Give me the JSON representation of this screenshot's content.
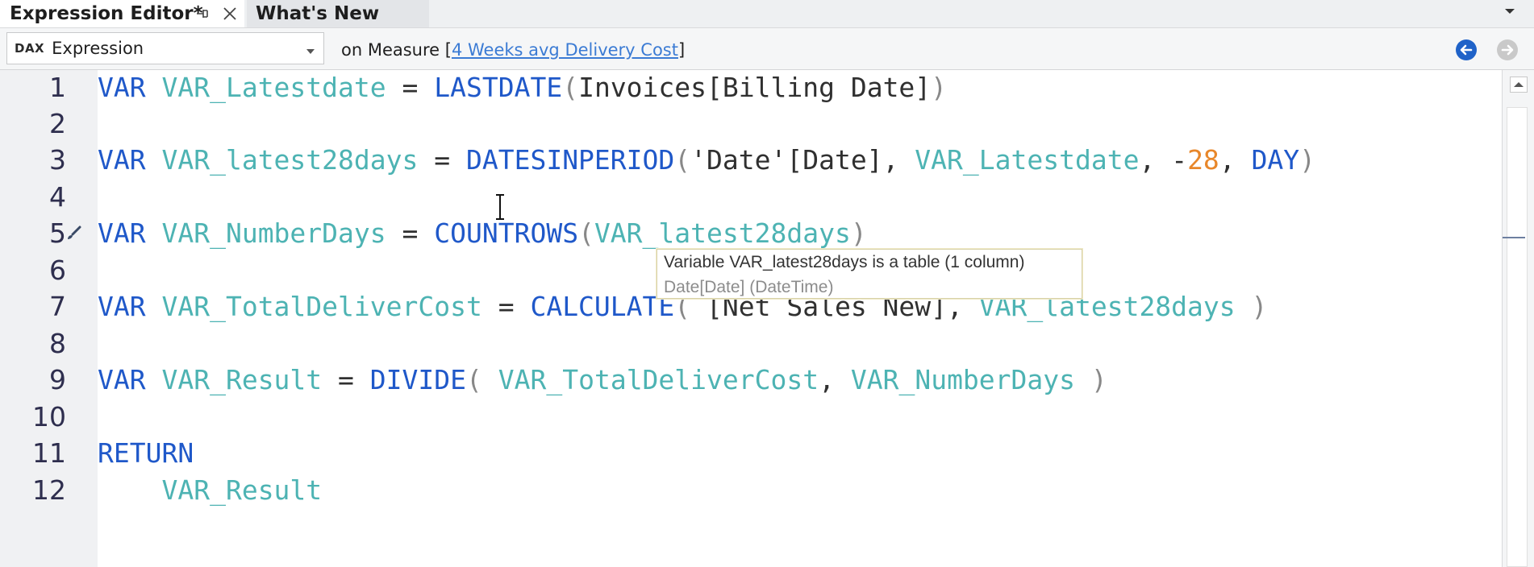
{
  "tabs": {
    "active_title": "Expression Editor*",
    "inactive_title": "What's New"
  },
  "toolbar": {
    "language_badge": "DAX",
    "combo_value": "Expression",
    "context_prefix": "on Measure [",
    "measure_name": "4 Weeks avg Delivery Cost",
    "context_suffix": "]"
  },
  "editor": {
    "line_numbers": [
      "1",
      "2",
      "3",
      "4",
      "5",
      "6",
      "7",
      "8",
      "9",
      "10",
      "11",
      "12"
    ],
    "tooltip_line1": "Variable VAR_latest28days is a table (1 column)",
    "tooltip_line2": "Date[Date] (DateTime)"
  },
  "code": {
    "l1": {
      "kw": "VAR",
      "var": "VAR_Latestdate",
      "op": " = ",
      "fn": "LASTDATE",
      "arg": "Invoices[Billing Date]"
    },
    "l3": {
      "kw": "VAR",
      "var": "VAR_latest28days",
      "op": " = ",
      "fn": "DATESINPERIOD",
      "a1": "'Date'[Date], ",
      "a2": "VAR_Latestdate",
      "a3": ", -",
      "num": "28",
      "a4": ", ",
      "a5": "DAY"
    },
    "l5": {
      "kw": "VAR",
      "var": "VAR_NumberDays",
      "op": " = ",
      "fn": "COUNTROWS",
      "arg": "VAR_latest28days"
    },
    "l7": {
      "kw": "VAR",
      "var": "VAR_TotalDeliverCost",
      "op": " = ",
      "fn": "CALCULATE",
      "a1": " [Net Sales New], ",
      "a2": "VAR_latest28days"
    },
    "l9": {
      "kw": "VAR",
      "var": "VAR_Result",
      "op": " = ",
      "fn": "DIVIDE",
      "a1": "VAR_TotalDeliverCost",
      "a2": ", ",
      "a3": "VAR_NumberDays"
    },
    "l11": {
      "kw": "RETURN"
    },
    "l12": {
      "var": "VAR_Result"
    }
  },
  "colors": {
    "keyword": "#1f58c9",
    "variable": "#4db3b3",
    "number": "#e8872a",
    "link": "#3b7bd4"
  },
  "icons": [
    "pin-icon",
    "close-icon",
    "chevron-down-icon",
    "back-arrow-icon",
    "forward-arrow-icon",
    "brush-icon",
    "text-cursor-icon",
    "scroll-up-icon"
  ]
}
